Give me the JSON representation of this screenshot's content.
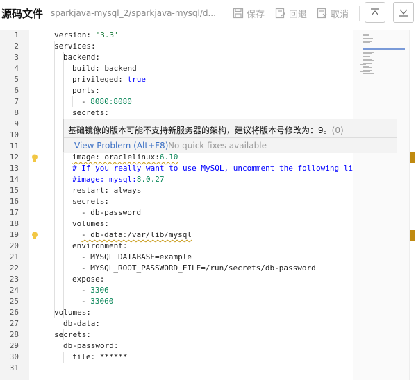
{
  "header": {
    "title": "源码文件",
    "path": "sparkjava-mysql_2/sparkjava-mysql/d...",
    "save_label": "保存",
    "revert_label": "回退",
    "cancel_label": "取消",
    "collapse_up_icon": "collapse-top-icon",
    "collapse_down_icon": "collapse-bottom-icon"
  },
  "editor": {
    "line_numbers": [
      "1",
      "2",
      "3",
      "4",
      "5",
      "6",
      "7",
      "8",
      "9",
      "10",
      "11",
      "12",
      "13",
      "14",
      "15",
      "16",
      "17",
      "18",
      "19",
      "20",
      "21",
      "22",
      "23",
      "24",
      "25",
      "26",
      "27",
      "28",
      "29",
      "30",
      "31"
    ],
    "lines": {
      "l1a": "version: ",
      "l1b": "'3.3'",
      "l2": "services:",
      "l3": "backend:",
      "l4": "build: backend",
      "l5a": "privileged: ",
      "l5b": "true",
      "l6": "ports:",
      "l7a": "- ",
      "l7b": "8080:8080",
      "l8": "secrets:",
      "l12a": "image: oraclelinux:",
      "l12b": "6.10",
      "l13": "# If you really want to use MySQL, uncomment the following lin",
      "l14a": "#image: mysql:",
      "l14b": "8.0.27",
      "l15": "restart: always",
      "l16": "secrets:",
      "l17": "- db-password",
      "l18": "volumes:",
      "l19": "- db-data:/var/lib/mysql",
      "l20": "environment:",
      "l21": "- MYSQL_DATABASE=example",
      "l22": "- MYSQL_ROOT_PASSWORD_FILE=/run/secrets/db-password",
      "l23": "expose:",
      "l24a": "- ",
      "l24b": "3306",
      "l25a": "- ",
      "l25b": "33060",
      "l26": "volumes:",
      "l27": "db-data:",
      "l28": "secrets:",
      "l29": "db-password:",
      "l30": "file: ******"
    }
  },
  "hover": {
    "message": "基础镜像的版本可能不支持新服务器的架构，建议将版本号修改为：9。",
    "code": "(0)",
    "view_problem": "View Problem (Alt+F8)",
    "no_fixes": "No quick fixes available"
  },
  "colors": {
    "warning": "#c08a10",
    "link": "#3a6fc4"
  }
}
